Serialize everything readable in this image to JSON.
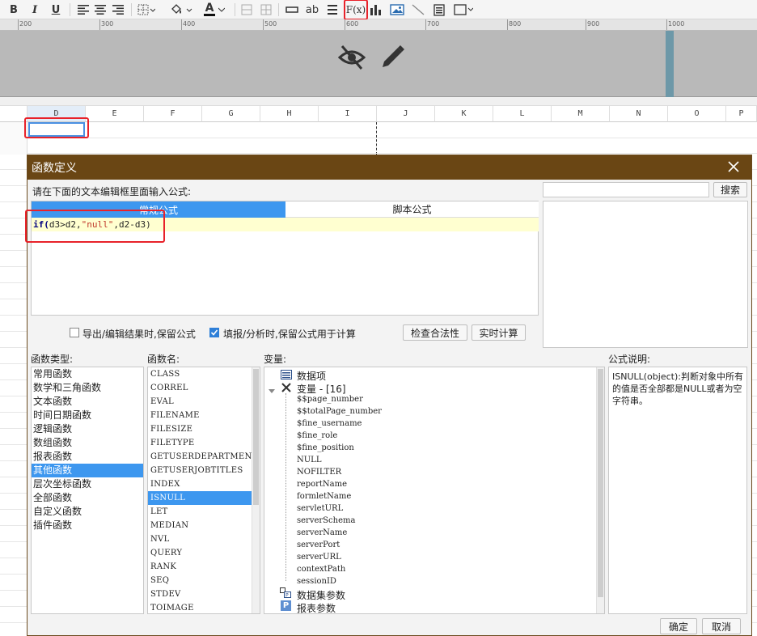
{
  "toolbar": {
    "bold": "B",
    "italic": "I",
    "underline": "U",
    "text_style": "ab",
    "formula": "F(x)",
    "font_color_letter": "A"
  },
  "ruler": {
    "labels": [
      "200",
      "300",
      "400",
      "500",
      "600",
      "700",
      "800",
      "900",
      "1000"
    ]
  },
  "columns": [
    "D",
    "E",
    "F",
    "G",
    "H",
    "I",
    "J",
    "K",
    "L",
    "M",
    "N",
    "O",
    "P"
  ],
  "dialog": {
    "title": "函数定义",
    "instruction": "请在下面的文本编辑框里面输入公式:",
    "tabs": [
      "常规公式",
      "脚本公式"
    ],
    "formula": {
      "part1": "if(",
      "part2": "d3>d2,",
      "string": "\"null\"",
      "part3": ",d2-d3)"
    },
    "search_button": "搜索",
    "options": {
      "keep_on_export": "导出/编辑结果时,保留公式",
      "keep_on_fill": "填报/分析时,保留公式用于计算"
    },
    "check_button": "检查合法性",
    "calc_button": "实时计算",
    "labels": {
      "func_types": "函数类型:",
      "func_names": "函数名:",
      "variables": "变量:",
      "description": "公式说明:"
    },
    "func_types": [
      "常用函数",
      "数学和三角函数",
      "文本函数",
      "时间日期函数",
      "逻辑函数",
      "数组函数",
      "报表函数",
      "其他函数",
      "层次坐标函数",
      "全部函数",
      "自定义函数",
      "插件函数"
    ],
    "selected_func_type": 7,
    "func_names": [
      "CLASS",
      "CORREL",
      "EVAL",
      "FILENAME",
      "FILESIZE",
      "FILETYPE",
      "GETUSERDEPARTMENTS",
      "GETUSERJOBTITLES",
      "INDEX",
      "ISNULL",
      "LET",
      "MEDIAN",
      "NVL",
      "QUERY",
      "RANK",
      "SEQ",
      "STDEV",
      "TOIMAGE"
    ],
    "selected_func_name": 9,
    "variables": {
      "data_items": "数据项",
      "var_group": "变量 - [16]",
      "items": [
        "$$page_number",
        "$$totalPage_number",
        "$fine_username",
        "$fine_role",
        "$fine_position",
        "NULL",
        "NOFILTER",
        "reportName",
        "formletName",
        "servletURL",
        "serverSchema",
        "serverName",
        "serverPort",
        "serverURL",
        "contextPath",
        "sessionID"
      ],
      "dataset_params": "数据集参数",
      "report_params": "报表参数"
    },
    "description_text": "ISNULL(object):判断对象中所有的值是否全部都是NULL或者为空字符串。",
    "ok": "确定",
    "cancel": "取消"
  },
  "colors": {
    "title_bar": "#6a4614",
    "selected": "#3d97ef",
    "highlight_red": "#e8222a",
    "formula_line": "#ffffd0"
  }
}
